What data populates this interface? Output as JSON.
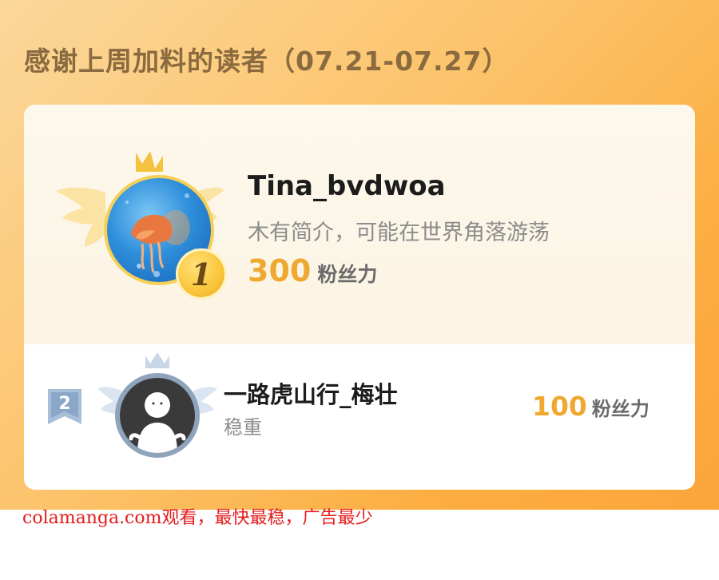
{
  "header": {
    "title": "感谢上周加料的读者（07.21-07.27）"
  },
  "colors": {
    "accent_number": "#f0a930",
    "banner": "#fcb848",
    "watermark": "#e41c1c"
  },
  "ranking": [
    {
      "rank": "1",
      "name": "Tina_bvdwoa",
      "bio": "木有简介，可能在世界角落游荡",
      "fans": "300",
      "fans_unit": "粉丝力",
      "avatar": "jellyfish-avatar",
      "badge": "gold-medal-icon"
    },
    {
      "rank": "2",
      "name": "一路虎山行_梅壮",
      "bio": "稳重",
      "fans": "100",
      "fans_unit": "粉丝力",
      "avatar": "default-person-avatar",
      "badge": "silver-rank-flag-icon"
    }
  ],
  "watermark": "colamanga.com观看，最快最稳，广告最少"
}
